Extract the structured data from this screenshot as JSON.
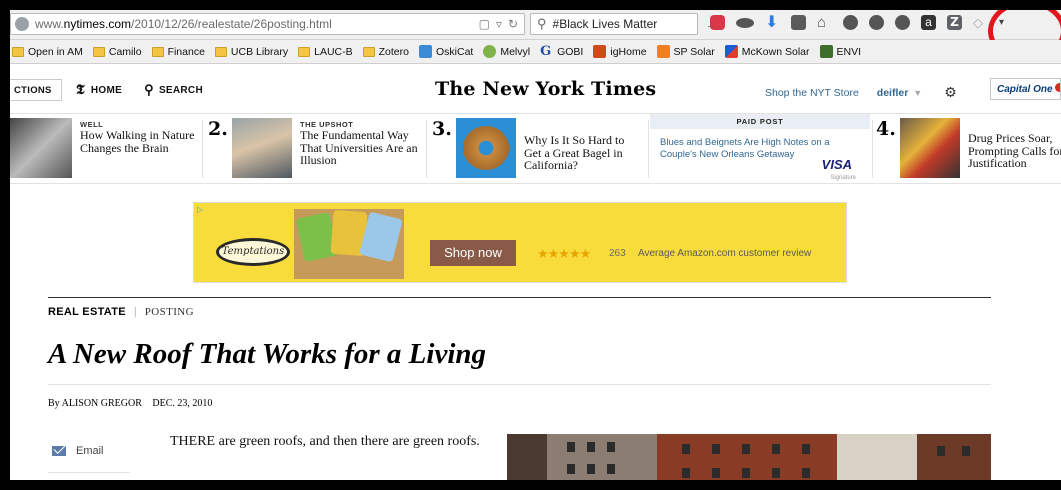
{
  "browser": {
    "url_prefix": "www.",
    "url_host": "nytimes.com",
    "url_path": "/2010/12/26/realestate/26posting.html",
    "search_query": "#Black Lives Matter",
    "toolbar_icons": [
      "pocket-icon",
      "reader-icon",
      "download-icon",
      "print-icon",
      "home-icon",
      "addon-icon",
      "addon2-icon",
      "chat-icon",
      "amazon-icon",
      "zotero-icon",
      "tag-icon",
      "menu-icon"
    ],
    "amazon_glyph": "a",
    "zotero_glyph": "Z"
  },
  "bookmarks": [
    {
      "label": "Open in AM",
      "type": "folder"
    },
    {
      "label": "Camilo",
      "type": "folder"
    },
    {
      "label": "Finance",
      "type": "folder"
    },
    {
      "label": "UCB Library",
      "type": "folder"
    },
    {
      "label": "LAUC-B",
      "type": "folder"
    },
    {
      "label": "Zotero",
      "type": "folder"
    },
    {
      "label": "OskiCat",
      "type": "link"
    },
    {
      "label": "Melvyl",
      "type": "link"
    },
    {
      "label": "GOBI",
      "type": "link"
    },
    {
      "label": "igHome",
      "type": "link"
    },
    {
      "label": "SP Solar",
      "type": "link"
    },
    {
      "label": "McKown Solar",
      "type": "link"
    },
    {
      "label": "ENVI",
      "type": "link"
    }
  ],
  "nyt": {
    "sections_label": "CTIONS",
    "home_label": "HOME",
    "search_label": "SEARCH",
    "logo": "The New York Times",
    "shop_link": "Shop the NYT Store",
    "user": "deifler",
    "sponsor": "Capital One"
  },
  "ribbon": {
    "story1": {
      "kicker": "WELL",
      "headline": "How Walking in Nature Changes the Brain"
    },
    "story2": {
      "num": "2.",
      "kicker": "THE UPSHOT",
      "headline": "The Fundamental Way That Universities Are an Illusion"
    },
    "story3": {
      "num": "3.",
      "headline": "Why Is It So Hard to Get a Great Bagel in California?"
    },
    "paid_post": {
      "label": "PAID POST",
      "headline": "Blues and Beignets Are High Notes on a Couple's New Orleans Getaway",
      "brand": "VISA",
      "brand_sub": "Signature"
    },
    "story4": {
      "num": "4.",
      "headline": "Drug Prices Soar, Prompting Calls for Justification"
    }
  },
  "ad": {
    "brand": "Temptations",
    "cta": "Shop now",
    "stars": "★★★★★",
    "review_count": "263",
    "review_text": "Average Amazon.com customer review",
    "rating": 5
  },
  "article": {
    "section": "REAL ESTATE",
    "subsection": "POSTING",
    "headline": "A New Roof That Works for a Living",
    "byline": "By ALISON GREGOR",
    "date": "DEC. 23, 2010",
    "share_email": "Email",
    "body": "THERE are green roofs, and then there are green roofs."
  },
  "colors": {
    "nyt_link": "#326891",
    "highlight_circle": "#e2161e",
    "ad_background": "#f8dc3c",
    "ad_button": "#8a5a48"
  }
}
